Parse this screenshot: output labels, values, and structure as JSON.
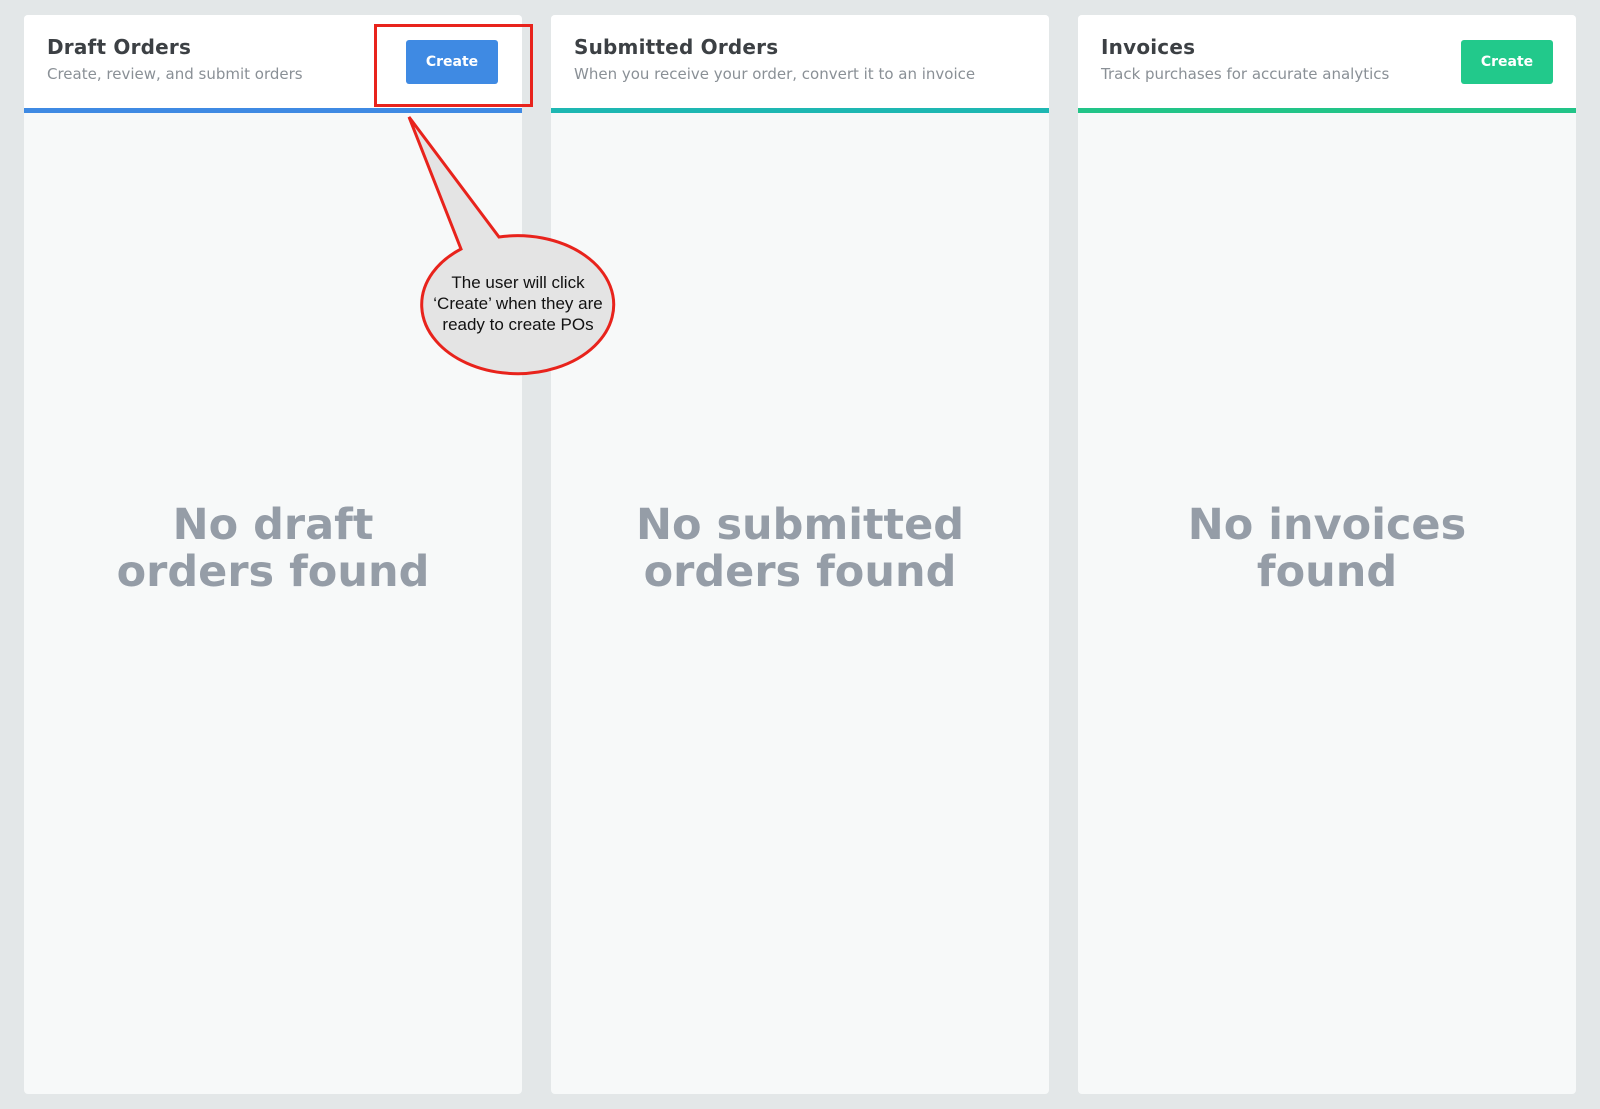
{
  "columns": {
    "draft": {
      "title": "Draft Orders",
      "subtitle": "Create, review, and submit orders",
      "create_label": "Create",
      "accent_color": "#3f8ae3",
      "button_color": "#3f8ae3",
      "empty_line1": "No draft",
      "empty_line2": "orders found"
    },
    "submitted": {
      "title": "Submitted Orders",
      "subtitle": "When you receive your order, convert it to an invoice",
      "accent_color": "#1eb7b2",
      "empty_line1": "No submitted",
      "empty_line2": "orders found"
    },
    "invoices": {
      "title": "Invoices",
      "subtitle": "Track purchases for accurate analytics",
      "create_label": "Create",
      "accent_color": "#22c488",
      "button_color": "#22c98b",
      "empty_line1": "No invoices",
      "empty_line2": "found"
    }
  },
  "annotation": {
    "line1": "The user will click",
    "line2": "‘Create’ when they are",
    "line3": "ready to create POs",
    "stroke_color": "#e8231c",
    "fill_color": "#e4e4e4"
  }
}
